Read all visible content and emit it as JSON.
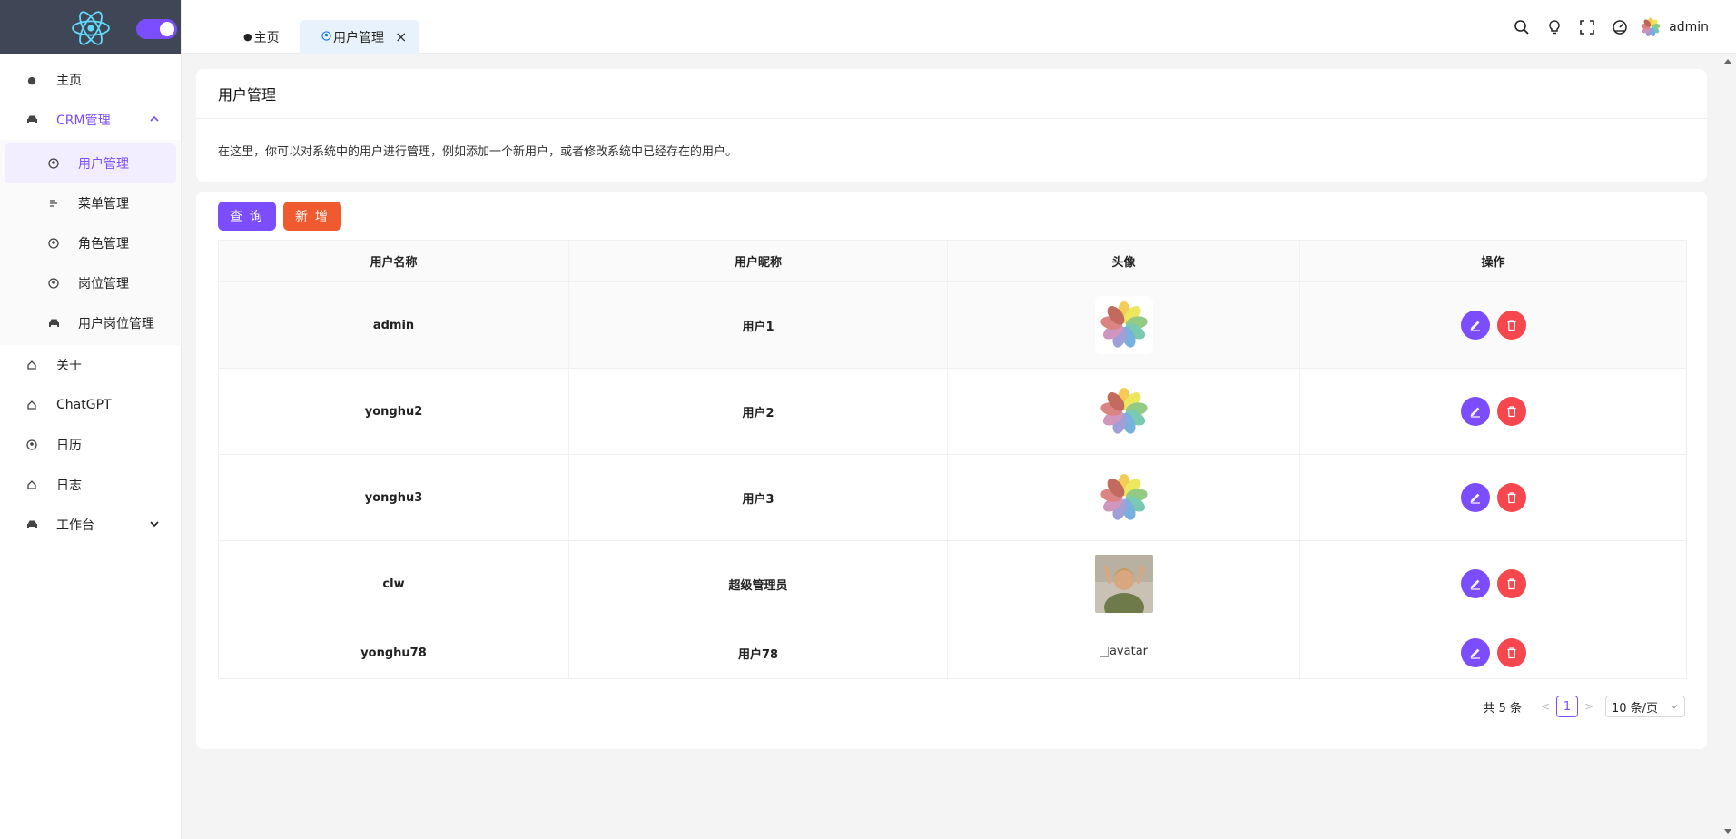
{
  "brand": {
    "accent": "#7c4dff",
    "danger": "#f5474d",
    "add": "#f05a2f",
    "sidebar_header": "#3f4756"
  },
  "sidebar": {
    "items": [
      {
        "label": "主页",
        "icon": "alien-icon"
      },
      {
        "label": "CRM管理",
        "icon": "car-icon",
        "expanded": true
      },
      {
        "label": "关于",
        "icon": "home-icon"
      },
      {
        "label": "ChatGPT",
        "icon": "home-icon"
      },
      {
        "label": "日历",
        "icon": "user-circle-icon"
      },
      {
        "label": "日志",
        "icon": "home-icon"
      },
      {
        "label": "工作台",
        "icon": "car-icon",
        "expanded": false
      }
    ],
    "submenu": [
      {
        "label": "用户管理",
        "icon": "user-circle-icon",
        "active": true
      },
      {
        "label": "菜单管理",
        "icon": "menu-lines-icon"
      },
      {
        "label": "角色管理",
        "icon": "user-circle-icon"
      },
      {
        "label": "岗位管理",
        "icon": "user-circle-icon"
      },
      {
        "label": "用户岗位管理",
        "icon": "car-icon"
      }
    ]
  },
  "tabs": [
    {
      "label": "主页",
      "icon": "alien-icon"
    },
    {
      "label": "用户管理",
      "icon": "user-circle-icon",
      "active": true
    }
  ],
  "header": {
    "username": "admin"
  },
  "page": {
    "title": "用户管理",
    "description": "在这里，你可以对系统中的用户进行管理，例如添加一个新用户，或者修改系统中已经存在的用户。"
  },
  "toolbar": {
    "query_label": "查 询",
    "add_label": "新 增"
  },
  "table": {
    "columns": [
      "用户名称",
      "用户昵称",
      "头像",
      "操作"
    ],
    "rows": [
      {
        "username": "admin",
        "nickname": "用户1",
        "avatar": "flower"
      },
      {
        "username": "yonghu2",
        "nickname": "用户2",
        "avatar": "flower"
      },
      {
        "username": "yonghu3",
        "nickname": "用户3",
        "avatar": "flower"
      },
      {
        "username": "clw",
        "nickname": "超级管理员",
        "avatar": "photo"
      },
      {
        "username": "yonghu78",
        "nickname": "用户78",
        "avatar": "broken",
        "avatar_alt": "avatar"
      }
    ]
  },
  "pagination": {
    "total_text": "共 5 条",
    "current_page": "1",
    "page_size": "10 条/页"
  }
}
